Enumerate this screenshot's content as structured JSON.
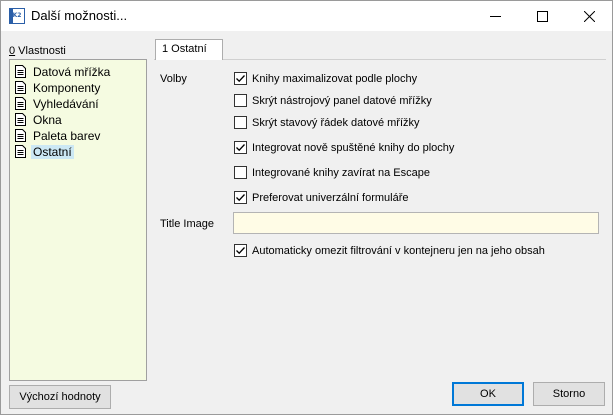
{
  "window": {
    "title": "Další možnosti...",
    "app_icon_text": "K2"
  },
  "panel": {
    "props_label_hotkey": "0",
    "props_label_rest": " Vlastnosti"
  },
  "tree": {
    "items": [
      {
        "label": "Datová mřížka",
        "selected": false
      },
      {
        "label": "Komponenty",
        "selected": false
      },
      {
        "label": "Vyhledávání",
        "selected": false
      },
      {
        "label": "Okna",
        "selected": false
      },
      {
        "label": "Paleta barev",
        "selected": false
      },
      {
        "label": "Ostatní",
        "selected": true
      }
    ]
  },
  "tabs": [
    {
      "label": "1 Ostatní",
      "active": true
    }
  ],
  "form": {
    "volby_label": "Volby",
    "options": [
      {
        "label": "Knihy maximalizovat podle plochy",
        "checked": true
      },
      {
        "label": "Skrýt nástrojový panel datové mřížky",
        "checked": false
      },
      {
        "label": "Skrýt stavový řádek datové mřížky",
        "checked": false
      },
      {
        "label": "Integrovat nově spuštěné knihy do plochy",
        "checked": true
      },
      {
        "label": "Integrované knihy zavírat na Escape",
        "checked": false
      },
      {
        "label": "Preferovat univerzální formuláře",
        "checked": true
      }
    ],
    "title_image_label": "Title Image",
    "title_image_value": "",
    "auto_filter": {
      "label": "Automaticky omezit filtrování v kontejneru jen na jeho obsah",
      "checked": true
    }
  },
  "buttons": {
    "defaults": "Výchozí hodnoty",
    "ok": "OK",
    "cancel": "Storno"
  }
}
